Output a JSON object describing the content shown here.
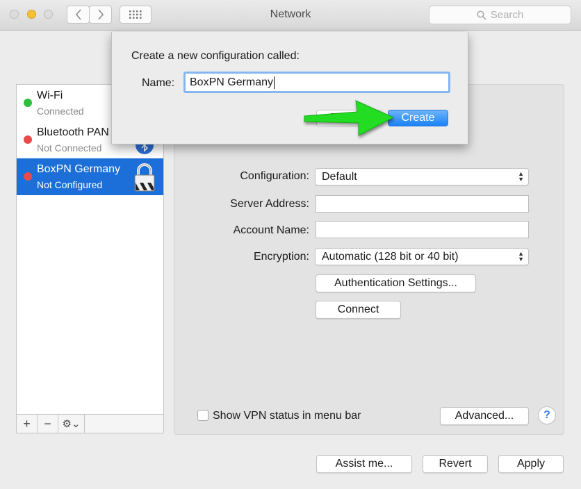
{
  "window": {
    "title": "Network",
    "search_placeholder": "Search"
  },
  "services": [
    {
      "name": "Wi-Fi",
      "status": "Connected",
      "dot_color": "#2fbf3f"
    },
    {
      "name": "Bluetooth PAN",
      "status": "Not Connected",
      "dot_color": "#e94b4b"
    },
    {
      "name": "BoxPN Germany",
      "status": "Not Configured",
      "dot_color": "#e94b4b"
    }
  ],
  "sidebar_toolbar": {
    "add": "+",
    "remove": "−",
    "action": "⚙⌄"
  },
  "main": {
    "configuration_label": "Configuration:",
    "configuration_value": "Default",
    "server_address_label": "Server Address:",
    "account_name_label": "Account Name:",
    "encryption_label": "Encryption:",
    "encryption_value": "Automatic (128 bit or 40 bit)",
    "auth_settings_button": "Authentication Settings...",
    "connect_button": "Connect",
    "show_vpn_status_label": "Show VPN status in menu bar",
    "advanced_button": "Advanced...",
    "help_button": "?"
  },
  "footer": {
    "assist_button": "Assist me...",
    "revert_button": "Revert",
    "apply_button": "Apply"
  },
  "dialog": {
    "prompt": "Create a new configuration called:",
    "name_label": "Name:",
    "name_value": "BoxPN Germany",
    "cancel_button_partial": "Car",
    "create_button": "Create"
  },
  "colors": {
    "selection": "#1c6fd8",
    "create_button": "#1a82f7",
    "arrow": "#22dd22"
  }
}
